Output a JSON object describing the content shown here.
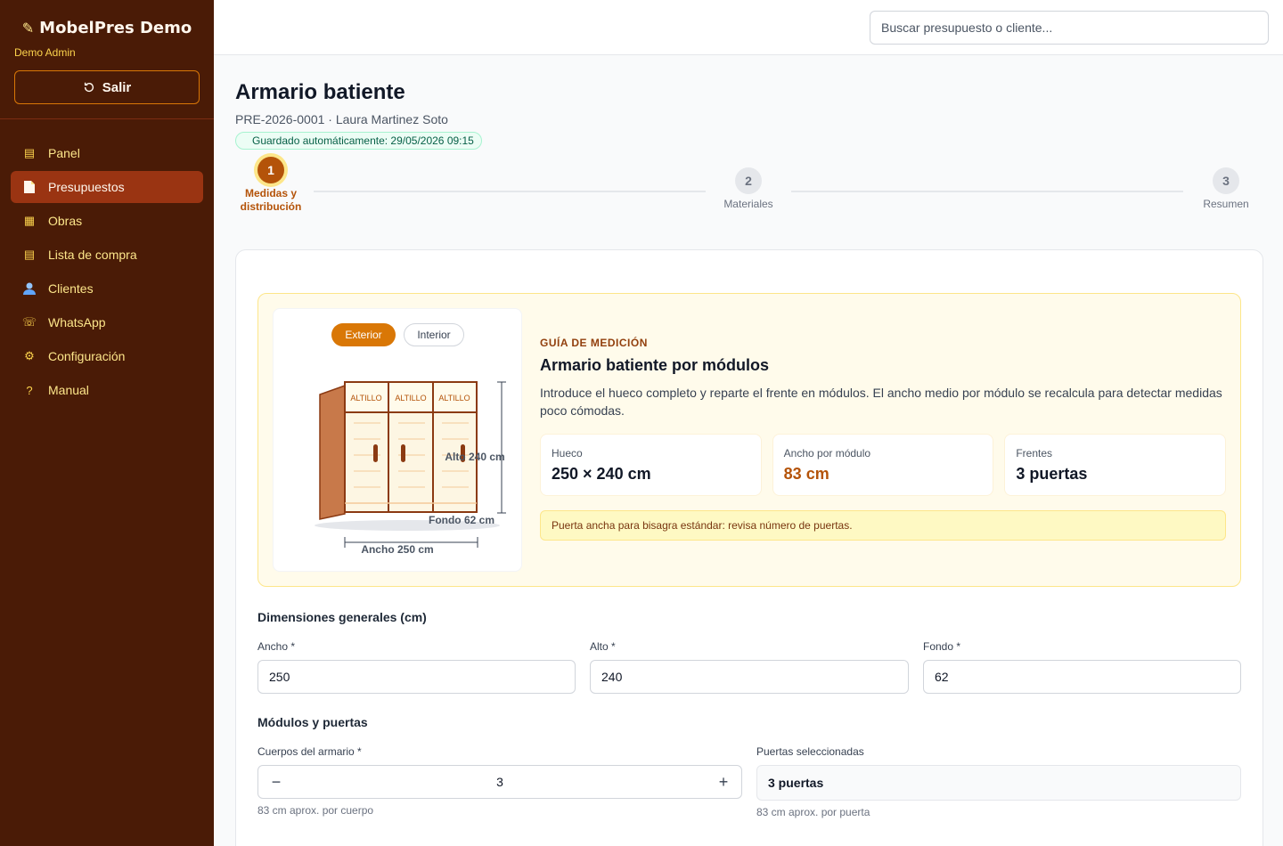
{
  "app": {
    "name": "MobelPres Demo",
    "user": "Demo Admin",
    "logout_label": "Salir"
  },
  "nav": [
    {
      "label": "Panel",
      "icon": "grid-icon",
      "active": false
    },
    {
      "label": "Presupuestos",
      "icon": "document-icon",
      "active": true
    },
    {
      "label": "Obras",
      "icon": "blocks-icon",
      "active": false
    },
    {
      "label": "Lista de compra",
      "icon": "list-icon",
      "active": false
    },
    {
      "label": "Clientes",
      "icon": "user-icon",
      "active": false
    },
    {
      "label": "WhatsApp",
      "icon": "phone-icon",
      "active": false
    },
    {
      "label": "Configuración",
      "icon": "gear-icon",
      "active": false
    },
    {
      "label": "Manual",
      "icon": "question-icon",
      "active": false
    }
  ],
  "search": {
    "placeholder": "Buscar presupuesto o cliente..."
  },
  "page": {
    "title": "Armario batiente",
    "subtitle": "PRE-2026-0001 · Laura Martinez Soto",
    "saved": "Guardado automáticamente: 29/05/2026 09:15"
  },
  "steps": [
    {
      "number": "1",
      "label": "Medidas y distribución",
      "active": true
    },
    {
      "number": "2",
      "label": "Materiales",
      "active": false
    },
    {
      "number": "3",
      "label": "Resumen",
      "active": false
    }
  ],
  "guide": {
    "toggle_exterior": "Exterior",
    "toggle_interior": "Interior",
    "drawing": {
      "module_label": "ALTILLO",
      "height_label": "Alto 240 cm",
      "depth_label": "Fondo 62 cm",
      "width_label": "Ancho 250 cm"
    },
    "eyebrow": "GUÍA DE MEDICIÓN",
    "title": "Armario batiente por módulos",
    "description": "Introduce el hueco completo y reparte el frente en módulos. El ancho medio por módulo se recalcula para detectar medidas poco cómodas.",
    "stats": [
      {
        "label": "Hueco",
        "value": "250 × 240 cm"
      },
      {
        "label": "Ancho por módulo",
        "value": "83 cm"
      },
      {
        "label": "Frentes",
        "value": "3 puertas"
      }
    ],
    "warning": "Puerta ancha para bisagra estándar: revisa número de puertas."
  },
  "dimensions": {
    "section_title": "Dimensiones generales (cm)",
    "ancho": {
      "label": "Ancho *",
      "value": "250"
    },
    "alto": {
      "label": "Alto *",
      "value": "240"
    },
    "fondo": {
      "label": "Fondo *",
      "value": "62"
    }
  },
  "modules": {
    "section_title": "Módulos y puertas",
    "bodies": {
      "label": "Cuerpos del armario *",
      "value": "3",
      "minus": "−",
      "plus": "+",
      "hint": "83 cm aprox. por cuerpo"
    },
    "doors": {
      "label": "Puertas seleccionadas",
      "value": "3 puertas",
      "hint": "83 cm aprox. por puerta"
    }
  },
  "colors": {
    "sidebar": "#4a1b06",
    "accent": "#b45309",
    "nav_active": "#9a3412"
  }
}
